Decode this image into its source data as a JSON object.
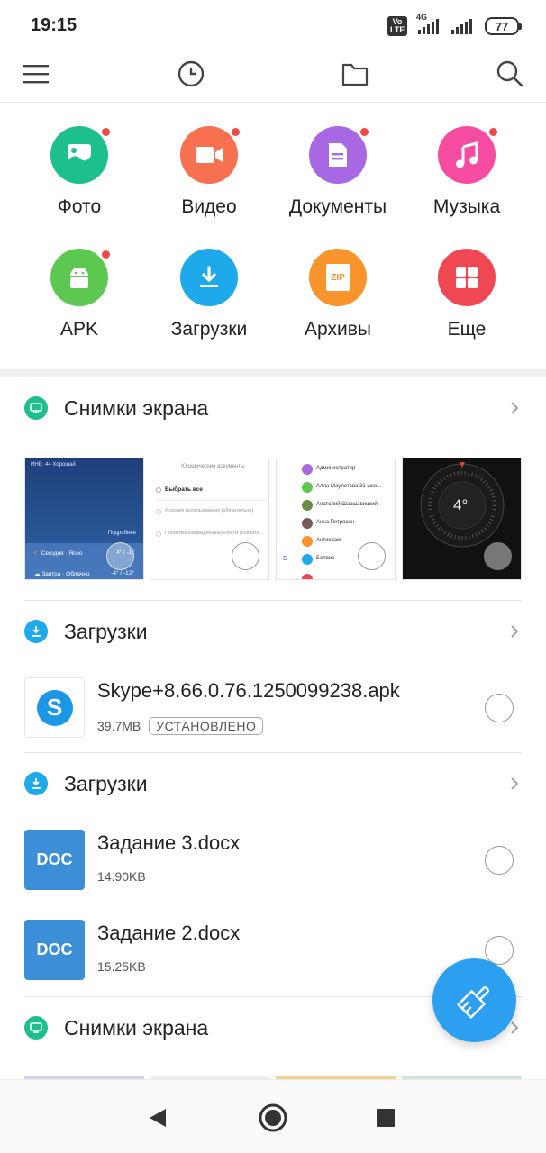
{
  "status_bar": {
    "time": "19:15",
    "volte_top": "Vo",
    "volte_bottom": "LTE",
    "network": "4G",
    "battery": "77"
  },
  "toolbar": {
    "icons": [
      "menu-icon",
      "clock-icon",
      "folder-icon",
      "search-icon"
    ]
  },
  "categories": [
    {
      "label": "Фото",
      "color": "#1dbf8f",
      "icon": "image-icon",
      "badge": true
    },
    {
      "label": "Видео",
      "color": "#f7704f",
      "icon": "video-icon",
      "badge": true
    },
    {
      "label": "Документы",
      "color": "#a868e3",
      "icon": "document-icon",
      "badge": true
    },
    {
      "label": "Музыка",
      "color": "#f54ba0",
      "icon": "music-icon",
      "badge": true
    },
    {
      "label": "APK",
      "color": "#5cc850",
      "icon": "android-icon",
      "badge": true
    },
    {
      "label": "Загрузки",
      "color": "#1ea9ea",
      "icon": "download-icon",
      "badge": false
    },
    {
      "label": "Архивы",
      "color": "#f9932c",
      "icon": "zip-icon",
      "badge": false,
      "icon_text": "ZIP"
    },
    {
      "label": "Еще",
      "color": "#f04853",
      "icon": "grid-icon",
      "badge": false
    }
  ],
  "sections": [
    {
      "title": "Снимки экрана",
      "icon": "screenshot-icon",
      "color": "#1dbf8f"
    },
    {
      "title": "Загрузки",
      "icon": "download-icon",
      "color": "#1ea9ea"
    },
    {
      "title": "Загрузки",
      "icon": "download-icon",
      "color": "#1ea9ea"
    },
    {
      "title": "Снимки экрана",
      "icon": "screenshot-icon",
      "color": "#1dbf8f"
    }
  ],
  "thumbnails": {
    "weather": {
      "header": "ИНВ: 44 Хорошай",
      "hint": "Подробнее",
      "today": "Сегодня · Ясно",
      "today_temp": "4° / -1°",
      "tomorrow": "Завтра · Облачно",
      "tomorrow_temp": "-4° / -12°"
    },
    "legal": {
      "header": "Юридические документы",
      "select_all": "Выбрать все",
      "terms": "Условия использования (обязательно)",
      "privacy": "Политика конфиденциальности (обязате..."
    },
    "contacts": {
      "items": [
        "Администратор",
        "Алла Маулетова 31 шко...",
        "Анатолий Шаршавицкий",
        "Анна Петросян",
        "Антиспам",
        "Белвис"
      ],
      "letter": "Б"
    },
    "compass": {
      "degrees": "4°"
    }
  },
  "files": [
    {
      "name": "Skype+8.66.0.76.1250099238.apk",
      "size": "39.7MB",
      "tag": "УСТАНОВЛЕНО",
      "icon": "skype-icon"
    },
    {
      "name": "Задание 3.docx",
      "size": "14.90KB",
      "icon_text": "DOC",
      "icon": "doc-icon"
    },
    {
      "name": "Задание 2.docx",
      "size": "15.25KB",
      "icon_text": "DOC",
      "icon": "doc-icon"
    }
  ],
  "fab": {
    "icon": "broom-icon",
    "color": "#2d9ff0"
  },
  "navbar": {
    "icons": [
      "back-icon",
      "home-icon",
      "recents-icon"
    ]
  }
}
